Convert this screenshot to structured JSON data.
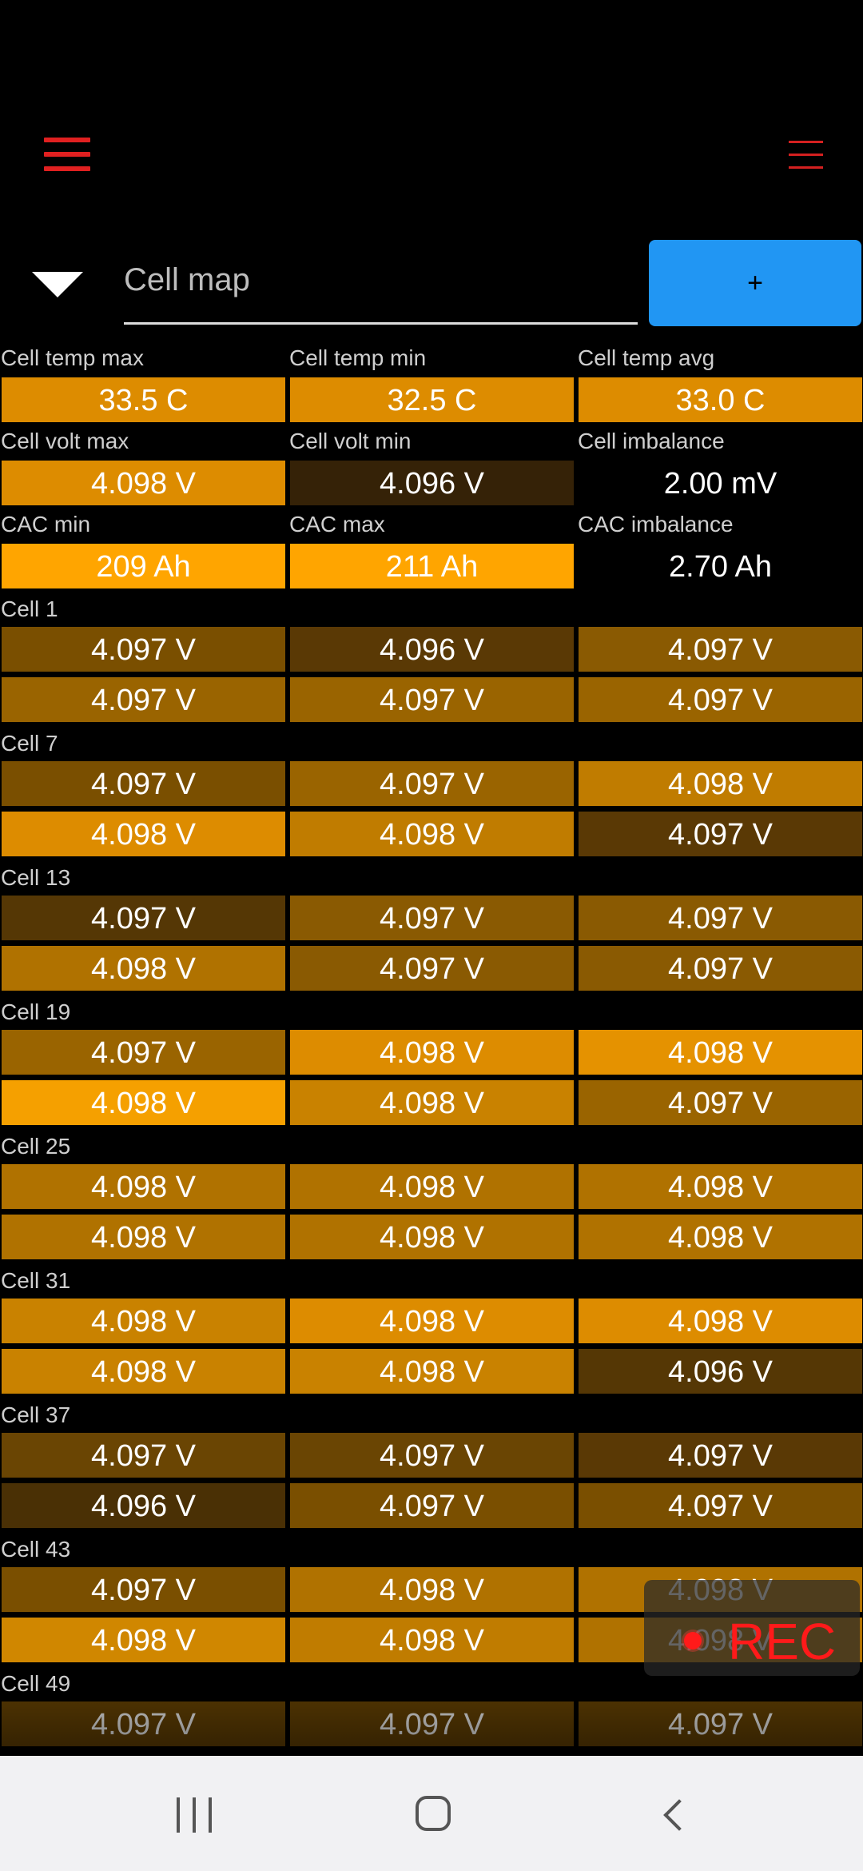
{
  "colors": {
    "background": "#000000",
    "menu_red": "#e02020",
    "accent_blue": "#2196f3",
    "cell_orange_full": "#ffa500"
  },
  "header": {
    "left_icon": "hamburger-menu-icon",
    "right_icon": "overflow-menu-icon"
  },
  "selector": {
    "dropdown_icon": "triangle-down-icon",
    "placeholder": "Cell map",
    "add_label": "+"
  },
  "summary": [
    {
      "label": "Cell temp max",
      "value": "33.5 C",
      "color": "#dd8c00"
    },
    {
      "label": "Cell temp min",
      "value": "32.5 C",
      "color": "#dd8c00"
    },
    {
      "label": "Cell temp avg",
      "value": "33.0 C",
      "color": "#dd8c00"
    },
    {
      "label": "Cell volt max",
      "value": "4.098 V",
      "color": "#dd8c00"
    },
    {
      "label": "Cell volt min",
      "value": "4.096 V",
      "color": "#352207"
    },
    {
      "label": "Cell imbalance",
      "value": "2.00 mV",
      "color": "#000000"
    },
    {
      "label": "CAC min",
      "value": "209 Ah",
      "color": "#ffa500"
    },
    {
      "label": "CAC max",
      "value": "211 Ah",
      "color": "#ffa500"
    },
    {
      "label": "CAC imbalance",
      "value": "2.70 Ah",
      "color": "#000000"
    }
  ],
  "groups": [
    {
      "label": "Cell 1",
      "rows": [
        [
          {
            "v": "4.097 V",
            "c": "#7a4f00"
          },
          {
            "v": "4.096 V",
            "c": "#5a3905"
          },
          {
            "v": "4.097 V",
            "c": "#8a5a02"
          }
        ],
        [
          {
            "v": "4.097 V",
            "c": "#9a6400"
          },
          {
            "v": "4.097 V",
            "c": "#9a6400"
          },
          {
            "v": "4.097 V",
            "c": "#9a6400"
          }
        ]
      ]
    },
    {
      "label": "Cell 7",
      "rows": [
        [
          {
            "v": "4.097 V",
            "c": "#7a4f00"
          },
          {
            "v": "4.097 V",
            "c": "#9a6400"
          },
          {
            "v": "4.098 V",
            "c": "#c07c00"
          }
        ],
        [
          {
            "v": "4.098 V",
            "c": "#dd8c00"
          },
          {
            "v": "4.098 V",
            "c": "#c07c00"
          },
          {
            "v": "4.097 V",
            "c": "#5a3905"
          }
        ]
      ]
    },
    {
      "label": "Cell 13",
      "rows": [
        [
          {
            "v": "4.097 V",
            "c": "#553705"
          },
          {
            "v": "4.097 V",
            "c": "#8a5a02"
          },
          {
            "v": "4.097 V",
            "c": "#8a5a02"
          }
        ],
        [
          {
            "v": "4.098 V",
            "c": "#b07200"
          },
          {
            "v": "4.097 V",
            "c": "#8a5a02"
          },
          {
            "v": "4.097 V",
            "c": "#8a5a02"
          }
        ]
      ]
    },
    {
      "label": "Cell 19",
      "rows": [
        [
          {
            "v": "4.097 V",
            "c": "#9a6400"
          },
          {
            "v": "4.098 V",
            "c": "#dd8c00"
          },
          {
            "v": "4.098 V",
            "c": "#e59200"
          }
        ],
        [
          {
            "v": "4.098 V",
            "c": "#f5a000"
          },
          {
            "v": "4.098 V",
            "c": "#c98200"
          },
          {
            "v": "4.097 V",
            "c": "#9a6400"
          }
        ]
      ]
    },
    {
      "label": "Cell 25",
      "rows": [
        [
          {
            "v": "4.098 V",
            "c": "#b07200"
          },
          {
            "v": "4.098 V",
            "c": "#b07200"
          },
          {
            "v": "4.098 V",
            "c": "#b07200"
          }
        ],
        [
          {
            "v": "4.098 V",
            "c": "#b07200"
          },
          {
            "v": "4.098 V",
            "c": "#b07200"
          },
          {
            "v": "4.098 V",
            "c": "#b07200"
          }
        ]
      ]
    },
    {
      "label": "Cell 31",
      "rows": [
        [
          {
            "v": "4.098 V",
            "c": "#c98200"
          },
          {
            "v": "4.098 V",
            "c": "#dd8c00"
          },
          {
            "v": "4.098 V",
            "c": "#dd8c00"
          }
        ],
        [
          {
            "v": "4.098 V",
            "c": "#c98200"
          },
          {
            "v": "4.098 V",
            "c": "#c98200"
          },
          {
            "v": "4.096 V",
            "c": "#553705"
          }
        ]
      ]
    },
    {
      "label": "Cell 37",
      "rows": [
        [
          {
            "v": "4.097 V",
            "c": "#6a4503"
          },
          {
            "v": "4.097 V",
            "c": "#6a4503"
          },
          {
            "v": "4.097 V",
            "c": "#5a3905"
          }
        ],
        [
          {
            "v": "4.096 V",
            "c": "#4a3005"
          },
          {
            "v": "4.097 V",
            "c": "#7a4f00"
          },
          {
            "v": "4.097 V",
            "c": "#7a4f00"
          }
        ]
      ]
    },
    {
      "label": "Cell 43",
      "rows": [
        [
          {
            "v": "4.097 V",
            "c": "#7a4f00"
          },
          {
            "v": "4.098 V",
            "c": "#b07200"
          },
          {
            "v": "4.098 V",
            "c": "#b07200"
          }
        ],
        [
          {
            "v": "4.098 V",
            "c": "#d08700"
          },
          {
            "v": "4.098 V",
            "c": "#c07c00"
          },
          {
            "v": "4.098 V",
            "c": "#b07200"
          }
        ]
      ]
    },
    {
      "label": "Cell 49",
      "rows": [
        [
          {
            "v": "4.097 V",
            "c": "#6a4503"
          },
          {
            "v": "4.097 V",
            "c": "#6a4503"
          },
          {
            "v": "4.097 V",
            "c": "#6a4503"
          }
        ]
      ]
    }
  ],
  "rec": {
    "label": "REC",
    "icon": "record-dot-icon"
  },
  "navbar": {
    "recent_icon": "recent-apps-icon",
    "home_icon": "home-icon",
    "back_icon": "back-icon"
  }
}
